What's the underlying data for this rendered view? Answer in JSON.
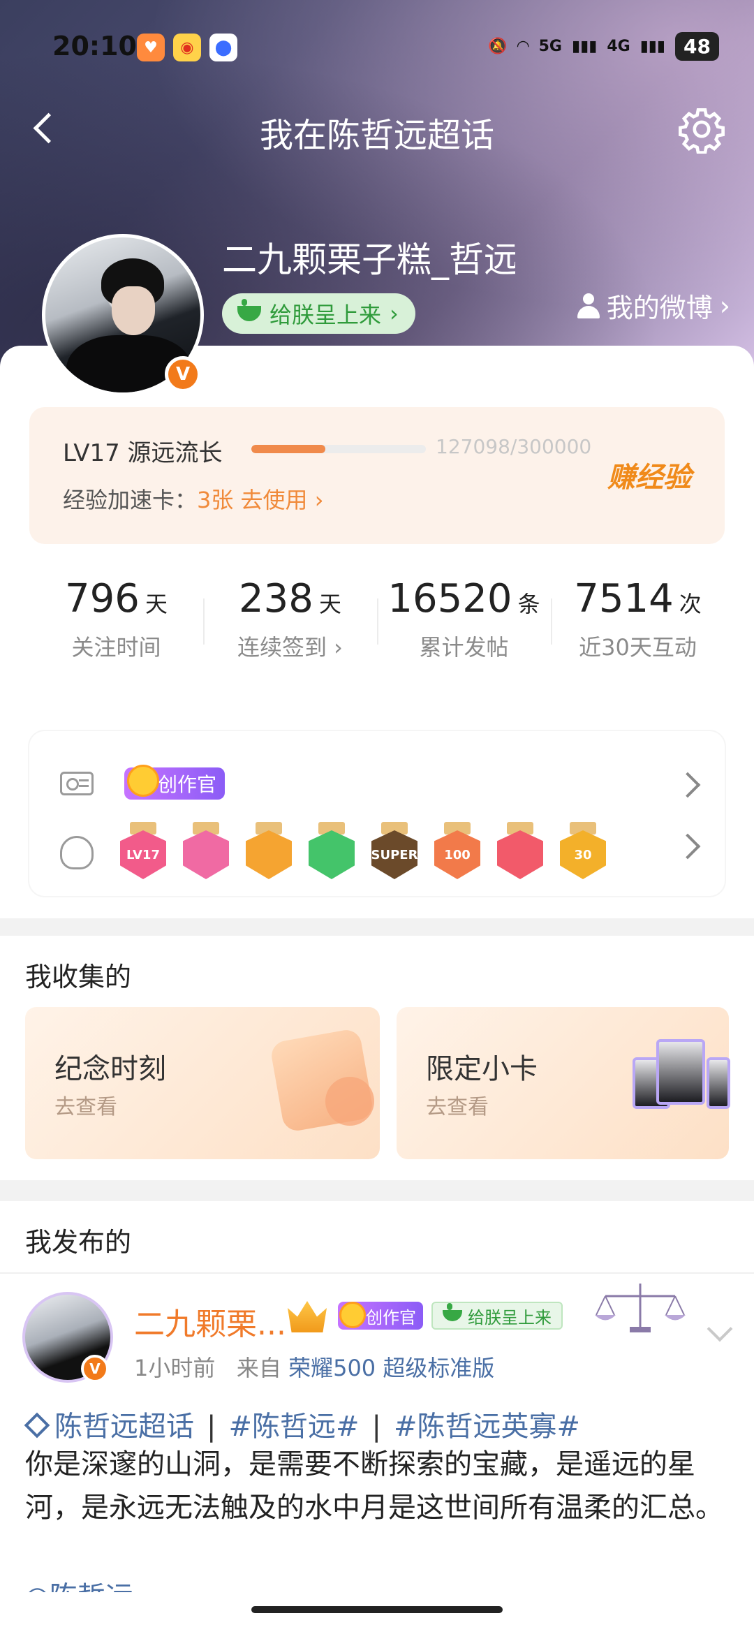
{
  "status": {
    "time": "20:10",
    "network_5g": "5G",
    "network_4g": "4G",
    "battery": "48"
  },
  "nav": {
    "title": "我在陈哲远超话"
  },
  "profile": {
    "username": "二九颗栗子糕_哲远",
    "reward_label": "给朕呈上来",
    "reward_chevron": "›",
    "my_weibo": "我的微博",
    "my_weibo_chevron": "›",
    "verified_mark": "V"
  },
  "level": {
    "title": "LV17 源远流长",
    "progress_text": "127098/300000",
    "progress_fraction": 0.4237,
    "earn_label": "赚经验",
    "speed_prefix": "经验加速卡：",
    "speed_count": "3张 去使用 ›"
  },
  "stats": [
    {
      "num": "796",
      "unit": "天",
      "label": "关注时间"
    },
    {
      "num": "238",
      "unit": "天",
      "label": "连续签到 ›"
    },
    {
      "num": "16520",
      "unit": "条",
      "label": "累计发帖"
    },
    {
      "num": "7514",
      "unit": "次",
      "label": "近30天互动"
    }
  ],
  "badges": {
    "creator_tag": "创作官",
    "medals": [
      {
        "text": "LV17",
        "color": "#f25b8a"
      },
      {
        "text": "",
        "color": "#f06aa3"
      },
      {
        "text": "",
        "color": "#f5a431"
      },
      {
        "text": "",
        "color": "#44c46a"
      },
      {
        "text": "SUPER",
        "color": "#6b4a2a"
      },
      {
        "text": "100",
        "color": "#f27a4a"
      },
      {
        "text": "",
        "color": "#f25a6a"
      },
      {
        "text": "30",
        "color": "#f3b02a"
      }
    ]
  },
  "collections": {
    "title": "我收集的",
    "items": [
      {
        "title": "纪念时刻",
        "sub": "去查看"
      },
      {
        "title": "限定小卡",
        "sub": "去查看"
      }
    ]
  },
  "posts": {
    "title": "我发布的",
    "author": "二九颗栗...",
    "creator_tag": "创作官",
    "reward_tag": "给朕呈上来",
    "time": "1小时前",
    "from_prefix": "来自",
    "device": "荣耀500 超级标准版",
    "tag1": "陈哲远超话",
    "tag2": "#陈哲远#",
    "tag3": "#陈哲远英寡#",
    "separator": "|",
    "text": "你是深邃的山洞，是需要不断探索的宝藏，是遥远的星河，是永远无法触及的水中月是这世间所有温柔的汇总。",
    "cut_line": "◎陈哲远"
  }
}
